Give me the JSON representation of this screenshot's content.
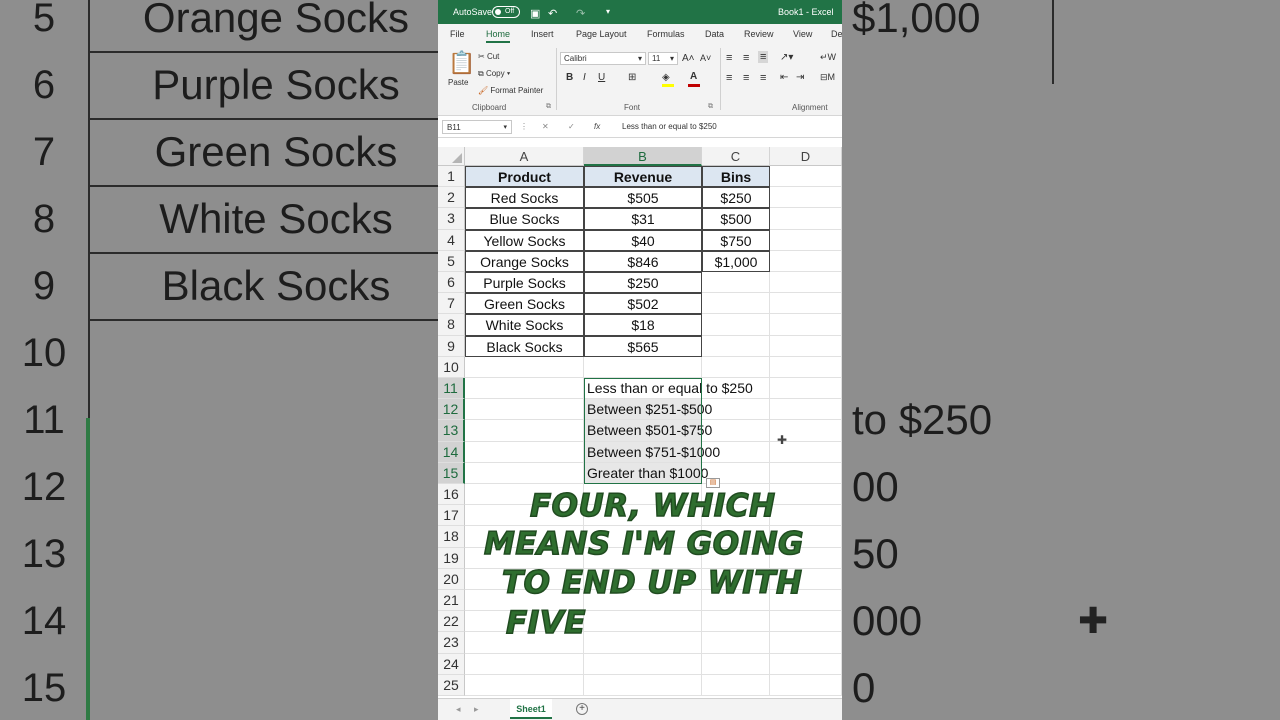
{
  "background": {
    "rows": [
      {
        "num": "5",
        "product": "Orange Socks",
        "value": "$1,000"
      },
      {
        "num": "6",
        "product": "Purple Socks",
        "value": ""
      },
      {
        "num": "7",
        "product": "Green Socks",
        "value": ""
      },
      {
        "num": "8",
        "product": "White Socks",
        "value": ""
      },
      {
        "num": "9",
        "product": "Black Socks",
        "value": ""
      },
      {
        "num": "10",
        "product": "",
        "value": ""
      },
      {
        "num": "11",
        "product": "",
        "value": "to $250"
      },
      {
        "num": "12",
        "product": "",
        "value": "00"
      },
      {
        "num": "13",
        "product": "",
        "value": "50"
      },
      {
        "num": "14",
        "product": "",
        "value": "000"
      },
      {
        "num": "15",
        "product": "",
        "value": "0"
      }
    ]
  },
  "titlebar": {
    "autosave": "AutoSave",
    "toggle": "Off",
    "title": "Book1 - Excel"
  },
  "tabs": [
    "File",
    "Home",
    "Insert",
    "Page Layout",
    "Formulas",
    "Data",
    "Review",
    "View",
    "De"
  ],
  "ribbon": {
    "paste": "Paste",
    "cut": "Cut",
    "copy": "Copy",
    "format_painter": "Format Painter",
    "clipboard": "Clipboard",
    "font_name": "Calibri",
    "font_size": "11",
    "font_group": "Font",
    "alignment_group": "Alignment",
    "bold": "B",
    "italic": "I",
    "underline": "U",
    "wrap": "W",
    "merge": "M"
  },
  "formula_bar": {
    "name_box": "B11",
    "fx": "fx",
    "formula": "Less than or equal to $250"
  },
  "columns": [
    "A",
    "B",
    "C",
    "D"
  ],
  "rows": [
    "1",
    "2",
    "3",
    "4",
    "5",
    "6",
    "7",
    "8",
    "9",
    "10",
    "11",
    "12",
    "13",
    "14",
    "15",
    "16",
    "17",
    "18",
    "19",
    "20",
    "21",
    "22",
    "23",
    "24",
    "25"
  ],
  "table": {
    "headers": {
      "product": "Product",
      "revenue": "Revenue",
      "bins": "Bins"
    },
    "products": [
      "Red Socks",
      "Blue Socks",
      "Yellow Socks",
      "Orange Socks",
      "Purple Socks",
      "Green Socks",
      "White Socks",
      "Black Socks"
    ],
    "revenue": [
      "$505",
      "$31",
      "$40",
      "$846",
      "$250",
      "$502",
      "$18",
      "$565"
    ],
    "bins": [
      "$250",
      "$500",
      "$750",
      "$1,000"
    ]
  },
  "labels": [
    "Less than or equal to $250",
    "Between $251-$500",
    "Between $501-$750",
    "Between $751-$1000",
    "Greater than $1000"
  ],
  "caption": [
    "FOUR, WHICH",
    "MEANS I'M GOING",
    "TO END UP WITH",
    "FIVE"
  ],
  "sheet": {
    "tab": "Sheet1",
    "add": "+"
  }
}
